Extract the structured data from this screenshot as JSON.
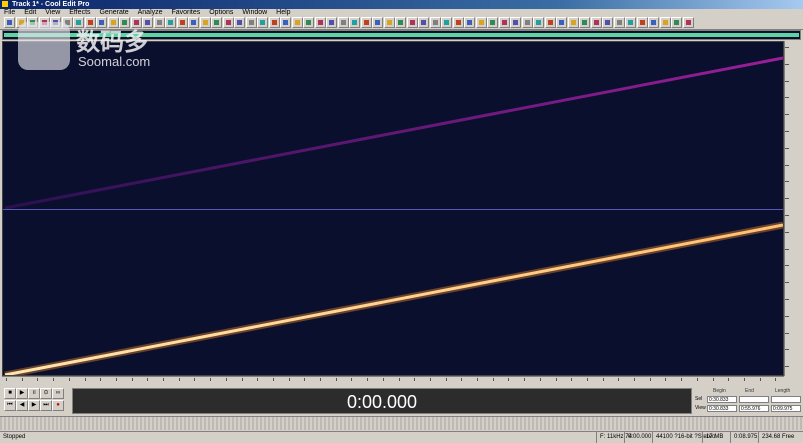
{
  "window": {
    "title": "Track 1* - Cool Edit Pro"
  },
  "menu": [
    "File",
    "Edit",
    "View",
    "Effects",
    "Generate",
    "Analyze",
    "Favorites",
    "Options",
    "Window",
    "Help"
  ],
  "time_display": "0:00.000",
  "selection": {
    "headers": [
      "Begin",
      "End",
      "Length"
    ],
    "rows": [
      {
        "label": "Sel",
        "begin": "0:30.833",
        "end": "",
        "length": ""
      },
      {
        "label": "View",
        "begin": "0:30.833",
        "end": "0:55.976",
        "length": "0:09.975"
      }
    ]
  },
  "status": {
    "left": "Stopped",
    "cells": [
      "F: 11kHz  74",
      "0:00.000",
      "44100 ?16-bit ?Stereo",
      "17 MB",
      "0:08.975",
      "234.68 Free"
    ]
  },
  "watermark": {
    "cn": "数码多",
    "en": "Soomal.com"
  },
  "colors": {
    "spectrum_bg": "#0b0f2e",
    "overview_wave": "#5fd3a8",
    "ch1_sweep": "#8a1a8f",
    "ch2_sweep": "#ffd9a0"
  },
  "icons": [
    "app-icon",
    "new-icon",
    "open-icon",
    "save-icon",
    "cut-icon",
    "copy-icon",
    "paste-icon",
    "undo-icon",
    "zoom-icon",
    "spectral-view-icon"
  ],
  "transport_icons": [
    "stop-icon",
    "play-icon",
    "pause-icon",
    "play-loop-icon",
    "record-icon",
    "to-start-icon",
    "rewind-icon",
    "forward-icon",
    "to-end-icon"
  ]
}
